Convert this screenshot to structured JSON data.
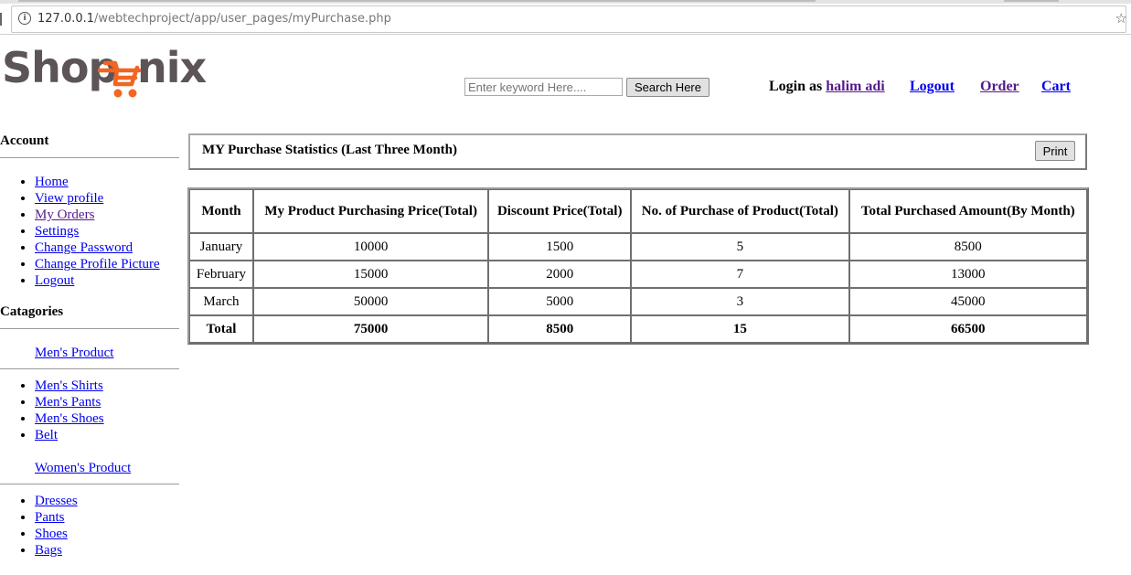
{
  "browser": {
    "url_host": "127.0.0.1",
    "url_path": "/webtechproject/app/user_pages/myPurchase.php"
  },
  "header": {
    "logo_text": "Shopnix",
    "search_placeholder": "Enter keyword Here....",
    "search_button": "Search Here",
    "login_prefix": "Login as",
    "username": "halim adi",
    "nav": {
      "logout": "Logout",
      "order": "Order",
      "cart": "Cart"
    }
  },
  "sidebar": {
    "account_title": "Account",
    "account_links": [
      "Home",
      "View profile",
      "My Orders",
      "Settings",
      "Change Password",
      "Change Profile Picture",
      "Logout"
    ],
    "categories_title": "Catagories",
    "mens_title": "Men's Product",
    "mens_links": [
      "Men's Shirts",
      "Men's Pants",
      "Men's Shoes",
      "Belt"
    ],
    "womens_title": "Women's Product",
    "womens_links": [
      "Dresses",
      "Pants",
      "Shoes",
      "Bags"
    ]
  },
  "main": {
    "title": "MY Purchase Statistics (Last Three Month)",
    "print_button": "Print",
    "table": {
      "headers": [
        "Month",
        "My Product Purchasing Price(Total)",
        "Discount Price(Total)",
        "No. of Purchase of Product(Total)",
        "Total Purchased Amount(By Month)"
      ],
      "rows": [
        [
          "January",
          "10000",
          "1500",
          "5",
          "8500"
        ],
        [
          "February",
          "15000",
          "2000",
          "7",
          "13000"
        ],
        [
          "March",
          "50000",
          "5000",
          "3",
          "45000"
        ]
      ],
      "total": [
        "Total",
        "75000",
        "8500",
        "15",
        "66500"
      ]
    }
  },
  "colors": {
    "logo_gray": "#5c5456",
    "logo_orange": "#f26522",
    "link": "#0000ee",
    "visited": "#551a8b"
  }
}
